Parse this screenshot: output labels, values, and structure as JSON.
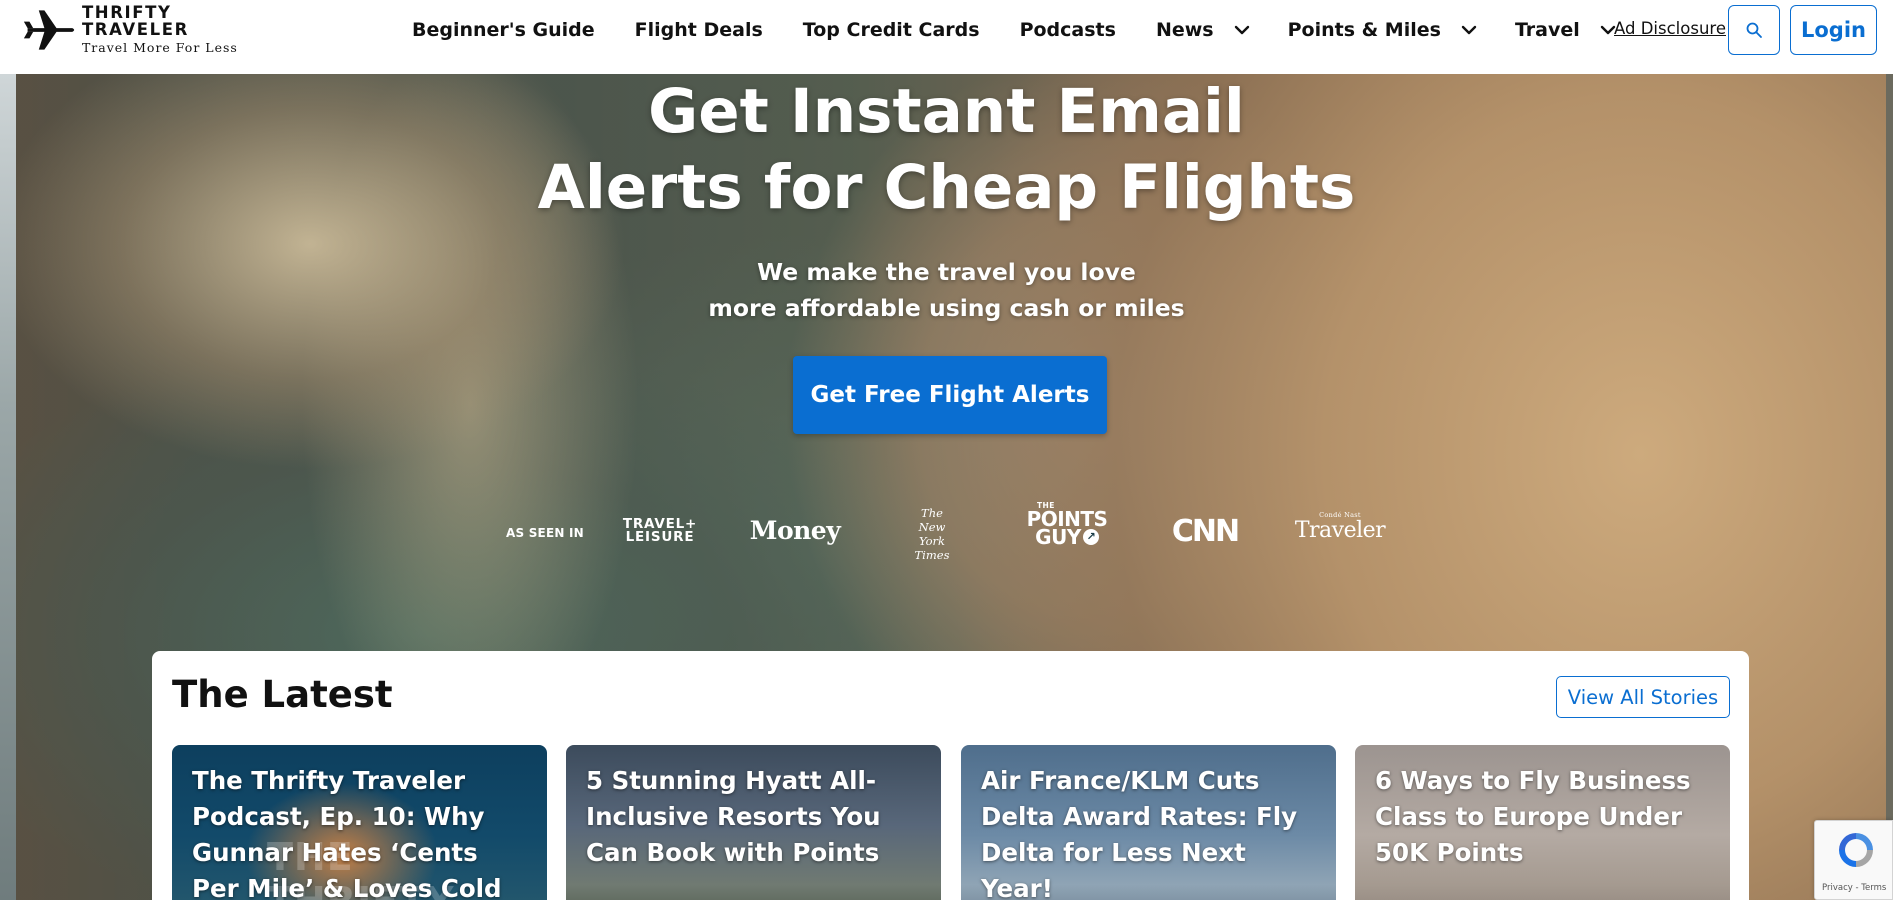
{
  "header": {
    "logo_name": "THRIFTY TRAVELER",
    "logo_tagline": "Travel More For Less",
    "nav": [
      {
        "label": "Beginner's Guide",
        "has_dropdown": false
      },
      {
        "label": "Flight Deals",
        "has_dropdown": false
      },
      {
        "label": "Top Credit Cards",
        "has_dropdown": false
      },
      {
        "label": "Podcasts",
        "has_dropdown": false
      },
      {
        "label": "News",
        "has_dropdown": true
      },
      {
        "label": "Points & Miles",
        "has_dropdown": true
      },
      {
        "label": "Travel",
        "has_dropdown": true
      }
    ],
    "ad_disclosure": "Ad Disclosure",
    "search_icon": "search-icon",
    "login_label": "Login"
  },
  "hero": {
    "title_line1": "Get Instant Email",
    "title_line2": "Alerts for Cheap Flights",
    "subtitle_line1": "We make the travel you love",
    "subtitle_line2": "more affordable using cash or miles",
    "cta_label": "Get Free Flight Alerts",
    "as_seen_in": "AS SEEN IN",
    "press": {
      "travel_leisure_1": "TRAVEL+",
      "travel_leisure_2": "LEISURE",
      "money": "Money",
      "nyt_1": "The",
      "nyt_2": "New York",
      "nyt_3": "Times",
      "tpg_small": "THE",
      "tpg_1": "POINTS",
      "tpg_2": "GUY",
      "cnn": "CNN",
      "traveler_small": "Condé Nast",
      "traveler": "Traveler"
    }
  },
  "latest": {
    "title": "The Latest",
    "view_all": "View All Stories",
    "cards": [
      {
        "title": "The Thrifty Traveler Podcast, Ep. 10: Why Gunnar Hates ‘Cents Per Mile’ & Loves Cold",
        "watermark": "THE THRIFTY"
      },
      {
        "title": "5 Stunning Hyatt All-Inclusive Resorts You Can Book with Points"
      },
      {
        "title": "Air France/KLM Cuts Delta Award Rates: Fly Delta for Less Next Year!"
      },
      {
        "title": "6 Ways to Fly Business Class to Europe Under 50K Points"
      }
    ]
  },
  "recaptcha": {
    "text": "Privacy - Terms"
  },
  "colors": {
    "accent": "#0a6ed1",
    "text": "#111111"
  }
}
